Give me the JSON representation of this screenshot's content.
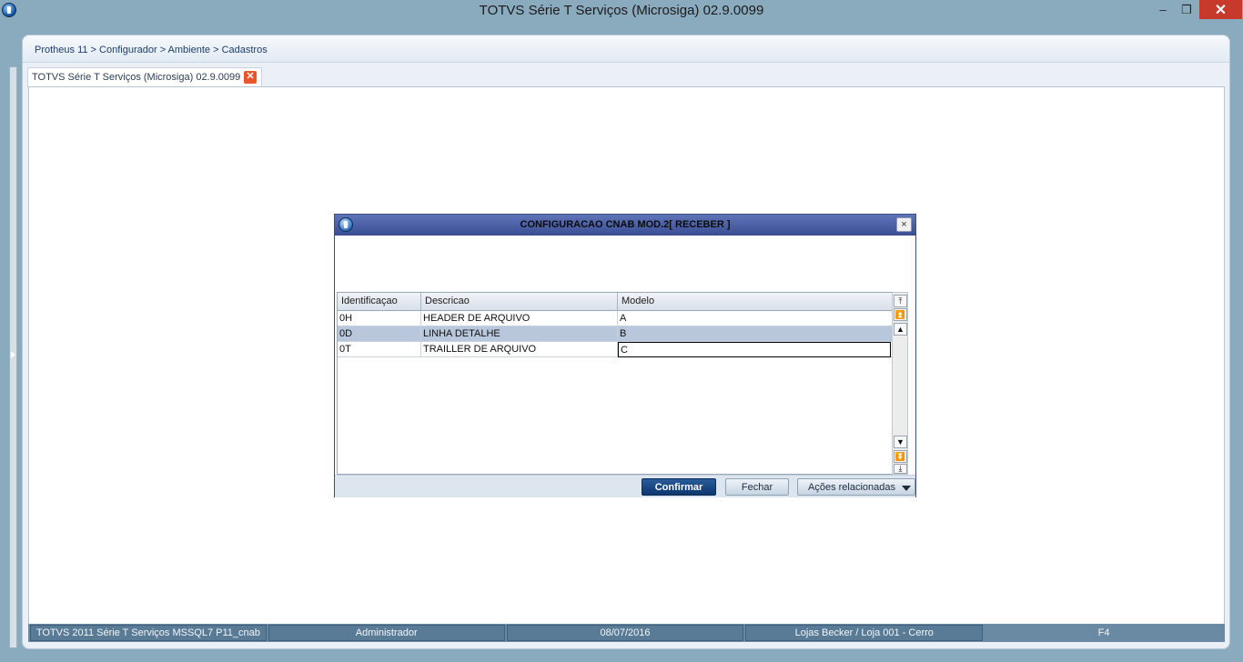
{
  "window": {
    "title": "TOTVS Série T Serviços (Microsiga) 02.9.0099",
    "minimize_glyph": "–",
    "maximize_glyph": "❐",
    "close_glyph": "✕"
  },
  "breadcrumb": "Protheus 11 > Configurador > Ambiente > Cadastros",
  "tab": {
    "label": "TOTVS Série T Serviços (Microsiga) 02.9.0099",
    "close_glyph": "✕"
  },
  "dialog": {
    "title": "CONFIGURACAO CNAB MOD.2[ RECEBER ]",
    "close_glyph": "×",
    "grid": {
      "columns": [
        "Identificaçao",
        "Descricao",
        "Modelo"
      ],
      "rows": [
        {
          "id": "0H",
          "descricao": "HEADER DE ARQUIVO",
          "modelo": "A"
        },
        {
          "id": "0D",
          "descricao": "LINHA DETALHE",
          "modelo": "B"
        },
        {
          "id": "0T",
          "descricao": "TRAILLER DE ARQUIVO",
          "modelo": "C"
        }
      ],
      "selected_row": 1
    },
    "buttons": {
      "confirm": "Confirmar",
      "close": "Fechar",
      "actions": "Ações relacionadas"
    }
  },
  "statusbar": {
    "env": "TOTVS 2011 Série T Serviços MSSQL7 P11_cnab",
    "user": "Administrador",
    "date": "08/07/2016",
    "branch": "Lojas Becker / Loja 001 - Cerro",
    "key": "F4"
  },
  "colors": {
    "title_band": "#8aaabe",
    "dialog_header": "#3a4f93",
    "primary_button": "#0d386f",
    "close_button": "#c7392b",
    "selected_row": "#b8c7dc"
  }
}
